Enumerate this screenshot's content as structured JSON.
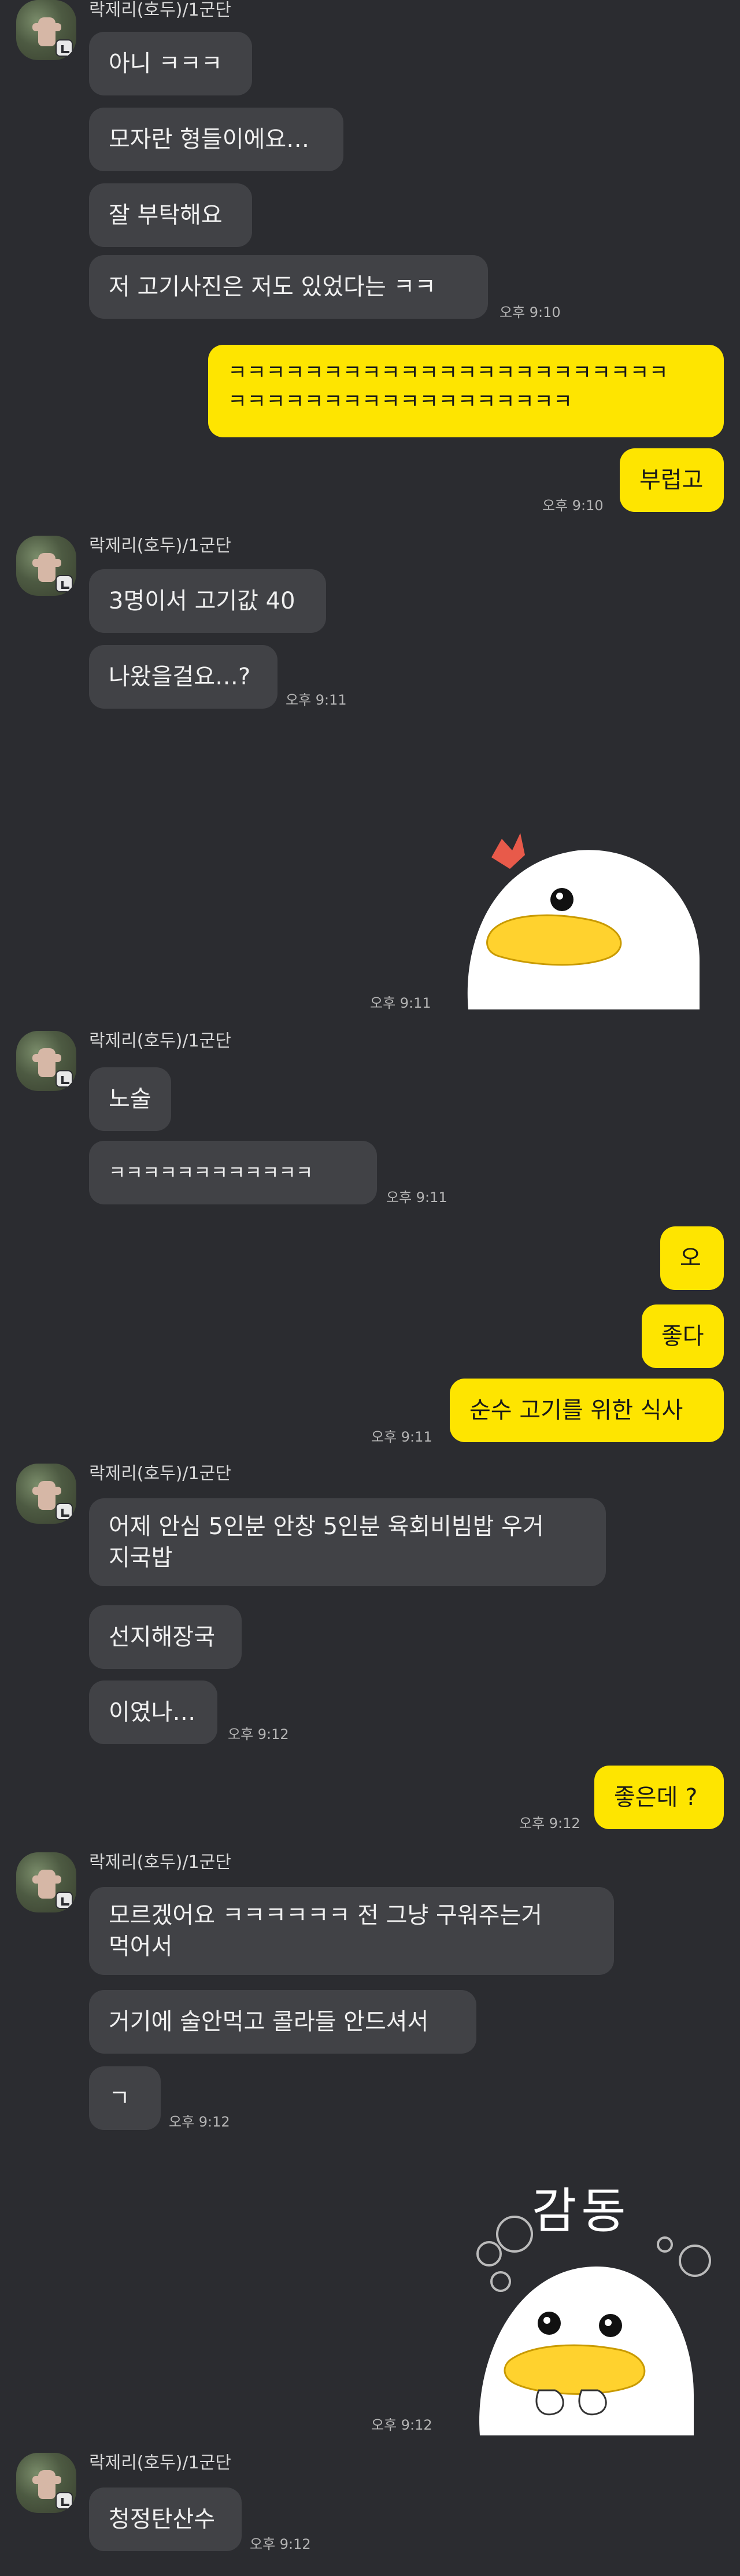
{
  "sender_name": "락제리(호두)/1군단",
  "m1": "아니 ㅋㅋㅋ",
  "m2": "모자란 형들이에요…",
  "m3": "잘 부탁해요",
  "m4": "저 고기사진은 저도 있었다는 ㅋㅋ",
  "t1": "오후 9:10",
  "m5_line1": "ㅋㅋㅋㅋㅋㅋㅋㅋㅋㅋㅋㅋㅋㅋㅋㅋㅋㅋㅋㅋㅋㅋㅋ",
  "m5_line2": "ㅋㅋㅋㅋㅋㅋㅋㅋㅋㅋㅋㅋㅋㅋㅋㅋㅋㅋ",
  "m6": "부럽고",
  "t2": "오후 9:10",
  "m7": "3명이서 고기값 40",
  "m8": "나왔을걸요…?",
  "t3": "오후 9:11",
  "t4": "오후 9:11",
  "m9": "노술",
  "m10": "ㅋㅋㅋㅋㅋㅋㅋㅋㅋㅋㅋㅋ",
  "t5": "오후 9:11",
  "m11": "오",
  "m12": "좋다",
  "m13": "순수 고기를 위한 식사",
  "t6": "오후 9:11",
  "m14_line1": "어제 안심 5인분 안창 5인분 육회비빔밥 우거",
  "m14_line2": "지국밥",
  "m15": "선지해장국",
  "m16": "이였나…",
  "t7": "오후 9:12",
  "m17": "좋은데 ?",
  "t8": "오후 9:12",
  "m18_line1": "모르겠어요 ㅋㅋㅋㅋㅋㅋ 전 그냥 구워주는거",
  "m18_line2": "먹어서",
  "m19": "거기에 술안먹고 콜라들 안드셔서",
  "m20": "ㄱ",
  "t9": "오후 9:12",
  "sticker2_text": "감동",
  "t10": "오후 9:12",
  "m21": "청정탄산수",
  "t11": "오후 9:12",
  "colors": {
    "background": "#2b2c30",
    "incoming_bubble": "#414246",
    "outgoing_bubble": "#fee500"
  },
  "icons": {
    "sticker1": "surprised-duck-sticker",
    "sticker2": "touched-duck-sticker"
  }
}
